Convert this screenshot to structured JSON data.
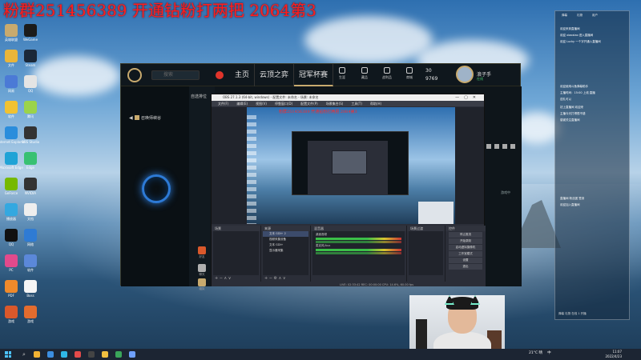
{
  "overlay": {
    "title": "粉群251456389 开通钻粉打两把 2064第3"
  },
  "desktop_icons": [
    {
      "label": "英雄联盟",
      "color": "#c8aa6e"
    },
    {
      "label": "WeGame",
      "color": "#1b1b1b"
    },
    {
      "label": "文件",
      "color": "#e9b53a"
    },
    {
      "label": "Steam",
      "color": "#1b2838"
    },
    {
      "label": "网易",
      "color": "#4b7ad6"
    },
    {
      "label": "QQ",
      "color": "#e4e4e4"
    },
    {
      "label": "软件",
      "color": "#f1c232"
    },
    {
      "label": "腾讯",
      "color": "#9bd34a"
    },
    {
      "label": "Internet Explorer",
      "color": "#2a8ddc"
    },
    {
      "label": "OBS Studio",
      "color": "#333333"
    },
    {
      "label": "Microsoft Edge",
      "color": "#1fa3d6"
    },
    {
      "label": "Edge",
      "color": "#38c172"
    },
    {
      "label": "GeForce",
      "color": "#76b900"
    },
    {
      "label": "NVIDIA",
      "color": "#333333"
    },
    {
      "label": "播放器",
      "color": "#34a8e0"
    },
    {
      "label": "文档",
      "color": "#eeeeee"
    },
    {
      "label": "QQ",
      "color": "#111111"
    },
    {
      "label": "网络",
      "color": "#2f7bd4"
    },
    {
      "label": "PC",
      "color": "#e24a8c"
    },
    {
      "label": "软件",
      "color": "#5b88d9"
    },
    {
      "label": "PDF",
      "color": "#ef8a2b"
    },
    {
      "label": "Boss",
      "color": "#f5f5f5"
    },
    {
      "label": "游戏",
      "color": "#d9582b"
    },
    {
      "label": "游戏",
      "color": "#e36c2e"
    }
  ],
  "lol": {
    "search_placeholder": "搜索",
    "nav": [
      "主页",
      "云顶之弈",
      "冠军杯赛"
    ],
    "icons": [
      {
        "name": "shield",
        "label": "生涯"
      },
      {
        "name": "bag",
        "label": "藏品"
      },
      {
        "name": "bag2",
        "label": "战利品"
      },
      {
        "name": "shop",
        "label": "商城"
      }
    ],
    "currency_rp": "30",
    "currency_be": "9769",
    "username": "浪子手",
    "status": "在线",
    "side_title": "召唤师峡谷",
    "title2": "自选排位",
    "chat_items": [
      "好友",
      "聊天",
      "组队"
    ],
    "right_text": "游戏中"
  },
  "obs": {
    "title": "OBS 27.1.3 (64-bit, windows) - 配置文件: 未命名 - 场景: 未命名",
    "menu": [
      "文件(F)",
      "编辑(E)",
      "视图(V)",
      "停靠窗口(D)",
      "配置文件(P)",
      "场景集合(S)",
      "工具(T)",
      "帮助(H)"
    ],
    "preview_title": "粉群251456389 开通钻粉打两把 2064第3",
    "docks": {
      "scenes": "场景",
      "sources": "来源",
      "mixer": "混音器",
      "transitions": "场景过渡",
      "controls": "控件"
    },
    "sources": [
      "文本 GDI+ 2",
      "视频采集设备",
      "文本 GDI+",
      "显示器采集"
    ],
    "mixer": [
      "桌面音频",
      "麦克风/Aux"
    ],
    "controls": [
      "停止推流",
      "开始录制",
      "启动虚拟摄像机",
      "工作室模式",
      "设置",
      "退出"
    ],
    "status": "LIVE: 02:33:42  REC: 00:00:00  CPU: 14.6%, 60.00 fps"
  },
  "chat": {
    "tabs": [
      "弹幕",
      "礼物",
      "用户"
    ],
    "lines": [
      "欢迎来到直播间",
      "欢迎 xiaoxiao 进入直播间",
      "欢迎 Lucky 一个字开通入直播间",
      "欢迎使用斗鱼弹幕助手",
      "主播时间：15:00 上线 直播",
      "送礼可以",
      "初上直播间 欢迎来",
      "主播今天打得很不错",
      "感谢关注直播间",
      "直播间 粉丝团 签到",
      "欢迎加入直播间"
    ],
    "bottom": "弹幕 礼物 在线 1 开播"
  },
  "taskbar": {
    "weather": "21°C 晴",
    "tray": "中",
    "time": "11:07",
    "date": "2022/4/23",
    "apps": [
      "#f2b233",
      "#3c8ee0",
      "#2fb7e6",
      "#e24a4a",
      "#444444",
      "#f0c040",
      "#3aa65a",
      "#6fa1ff"
    ]
  }
}
